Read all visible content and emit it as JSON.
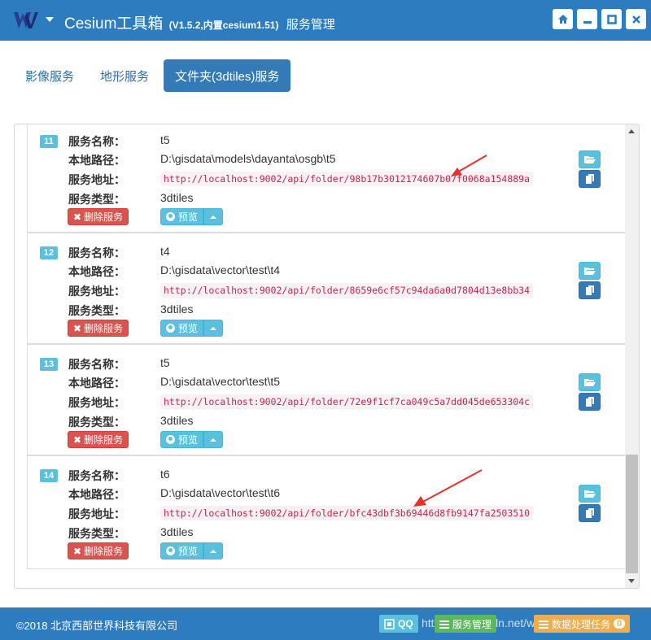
{
  "app": {
    "title": "Cesium工具箱",
    "version": "(V1.5.2,内置cesium1.51)",
    "subtitle": "服务管理"
  },
  "window_buttons": [
    {
      "name": "home-icon",
      "glyph": "⌂"
    },
    {
      "name": "minimize-icon",
      "glyph": "▬"
    },
    {
      "name": "maximize-icon",
      "glyph": "▢"
    },
    {
      "name": "close-icon",
      "glyph": "✕"
    }
  ],
  "tabs": [
    {
      "label": "影像服务",
      "active": false
    },
    {
      "label": "地形服务",
      "active": false
    },
    {
      "label": "文件夹(3dtiles)服务",
      "active": true
    }
  ],
  "labels": {
    "name": "服务名称：",
    "path": "本地路径：",
    "url": "服务地址：",
    "type": "服务类型：",
    "delete": "删除服务",
    "preview": "预览"
  },
  "services": [
    {
      "index": "11",
      "name": "t5",
      "path": "D:\\gisdata\\models\\dayanta\\osgb\\t5",
      "url": "http://localhost:9002/api/folder/98b17b3012174607b07f0068a154889a",
      "type": "3dtiles"
    },
    {
      "index": "12",
      "name": "t4",
      "path": "D:\\gisdata\\vector\\test\\t4",
      "url": "http://localhost:9002/api/folder/8659e6cf57c94da6a0d7804d13e8bb34",
      "type": "3dtiles"
    },
    {
      "index": "13",
      "name": "t5",
      "path": "D:\\gisdata\\vector\\test\\t5",
      "url": "http://localhost:9002/api/folder/72e9f1cf7ca049c5a7dd045de653304c",
      "type": "3dtiles"
    },
    {
      "index": "14",
      "name": "t6",
      "path": "D:\\gisdata\\vector\\test\\t6",
      "url": "http://localhost:9002/api/folder/bfc43dbf3b69446d8fb9147fa2503510",
      "type": "3dtiles"
    }
  ],
  "footer": {
    "copyright": "©2018 北京西部世界科技有限公司",
    "qq": "QQ",
    "btn_service": "服务管理",
    "btn_data": "数据处理任务",
    "data_count": "0",
    "watermark": "https://blog.csdn.net/weixin_4235"
  },
  "colors": {
    "primary": "#2e7cc0",
    "info": "#5bc0de",
    "danger": "#d9534f",
    "code": "#c7254e",
    "success": "#5cb85c",
    "warning": "#f0ad4e",
    "arrow": "#e8312a"
  }
}
